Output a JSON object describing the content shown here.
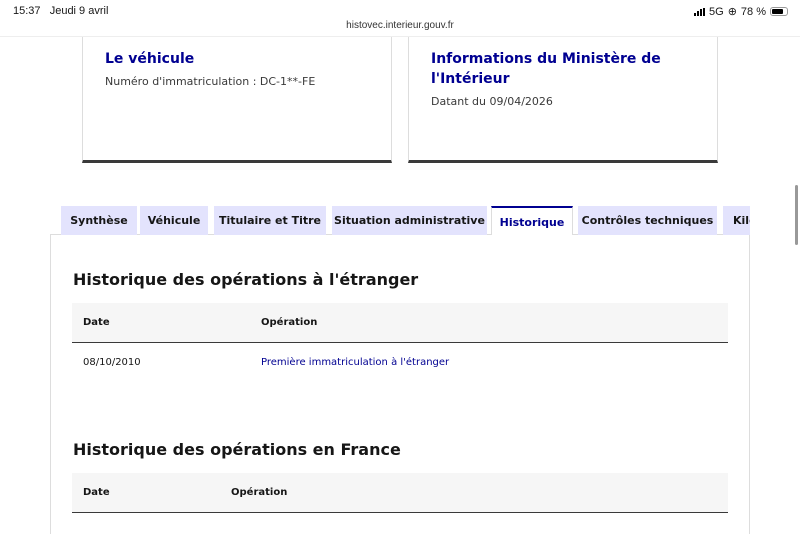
{
  "status_bar": {
    "time": "15:37",
    "date": "Jeudi 9 avril",
    "network": "5G",
    "battery": "78 %"
  },
  "browser": {
    "url": "histovec.interieur.gouv.fr"
  },
  "cards": [
    {
      "title": "Le véhicule",
      "text": "Numéro d'immatriculation : DC-1**-FE"
    },
    {
      "title": "Informations du Ministère de l'Intérieur",
      "text": "Datant du 09/04/2026"
    }
  ],
  "tabs": [
    "Synthèse",
    "Véhicule",
    "Titulaire et Titre",
    "Situation administrative",
    "Historique",
    "Contrôles techniques",
    "Kilométrage"
  ],
  "active_tab": "Historique",
  "sections": [
    {
      "title": "Historique des opérations à l'étranger",
      "columns": [
        "Date",
        "Opération"
      ],
      "rows": [
        {
          "date": "08/10/2010",
          "operation": "Première immatriculation à l'étranger"
        }
      ]
    },
    {
      "title": "Historique des opérations en France",
      "columns": [
        "Date",
        "Opération"
      ],
      "rows": []
    }
  ]
}
